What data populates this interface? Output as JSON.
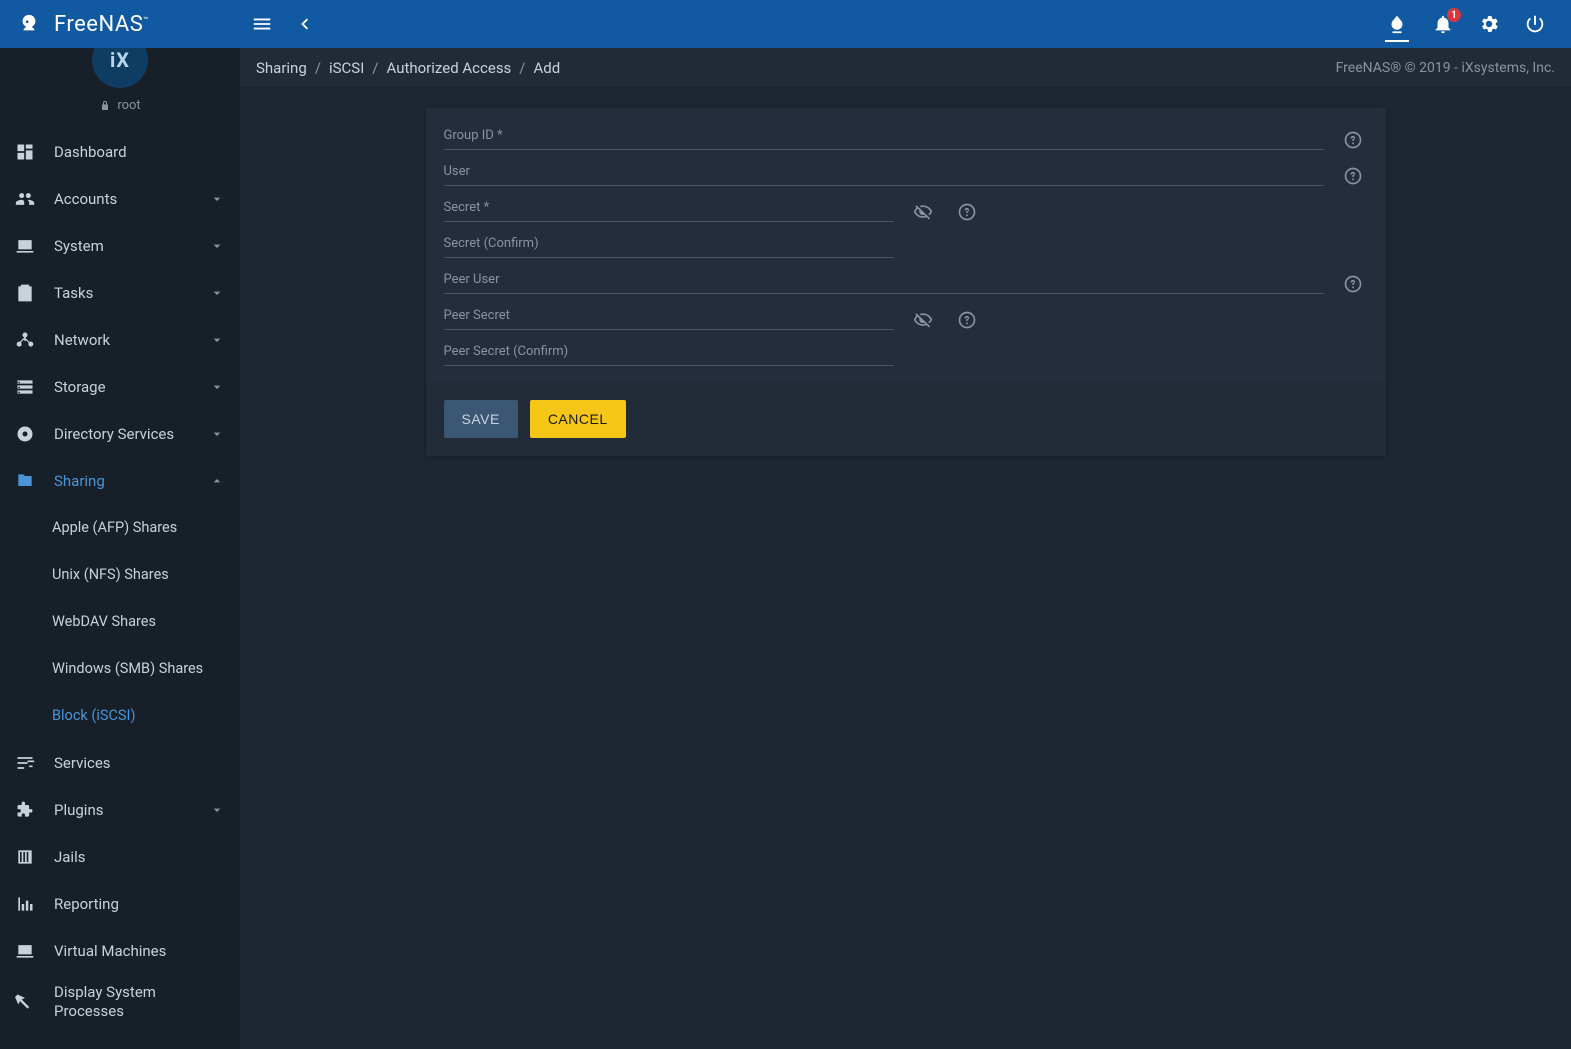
{
  "brand": {
    "name": "FreeNAS"
  },
  "topbar": {
    "notifications_count": "1"
  },
  "user": {
    "name": "root",
    "avatar_initials": "iX"
  },
  "sidebar": {
    "items": [
      {
        "label": "Dashboard"
      },
      {
        "label": "Accounts"
      },
      {
        "label": "System"
      },
      {
        "label": "Tasks"
      },
      {
        "label": "Network"
      },
      {
        "label": "Storage"
      },
      {
        "label": "Directory Services"
      },
      {
        "label": "Sharing"
      },
      {
        "label": "Services"
      },
      {
        "label": "Plugins"
      },
      {
        "label": "Jails"
      },
      {
        "label": "Reporting"
      },
      {
        "label": "Virtual Machines"
      },
      {
        "label": "Display System Processes"
      }
    ],
    "sharing_sub": [
      {
        "label": "Apple (AFP) Shares"
      },
      {
        "label": "Unix (NFS) Shares"
      },
      {
        "label": "WebDAV Shares"
      },
      {
        "label": "Windows (SMB) Shares"
      },
      {
        "label": "Block (iSCSI)"
      }
    ]
  },
  "breadcrumbs": {
    "parts": [
      "Sharing",
      "iSCSI",
      "Authorized Access",
      "Add"
    ],
    "sep": "/"
  },
  "footer": {
    "copyright": "FreeNAS® © 2019 - iXsystems, Inc."
  },
  "form": {
    "fields": {
      "group_id": {
        "label": "Group ID",
        "required_mark": "*"
      },
      "user": {
        "label": "User"
      },
      "secret": {
        "label": "Secret",
        "required_mark": "*"
      },
      "secret_confirm": {
        "label": "Secret (Confirm)"
      },
      "peer_user": {
        "label": "Peer User"
      },
      "peer_secret": {
        "label": "Peer Secret"
      },
      "peer_secret_confirm": {
        "label": "Peer Secret (Confirm)"
      }
    },
    "actions": {
      "save": "SAVE",
      "cancel": "CANCEL"
    }
  }
}
